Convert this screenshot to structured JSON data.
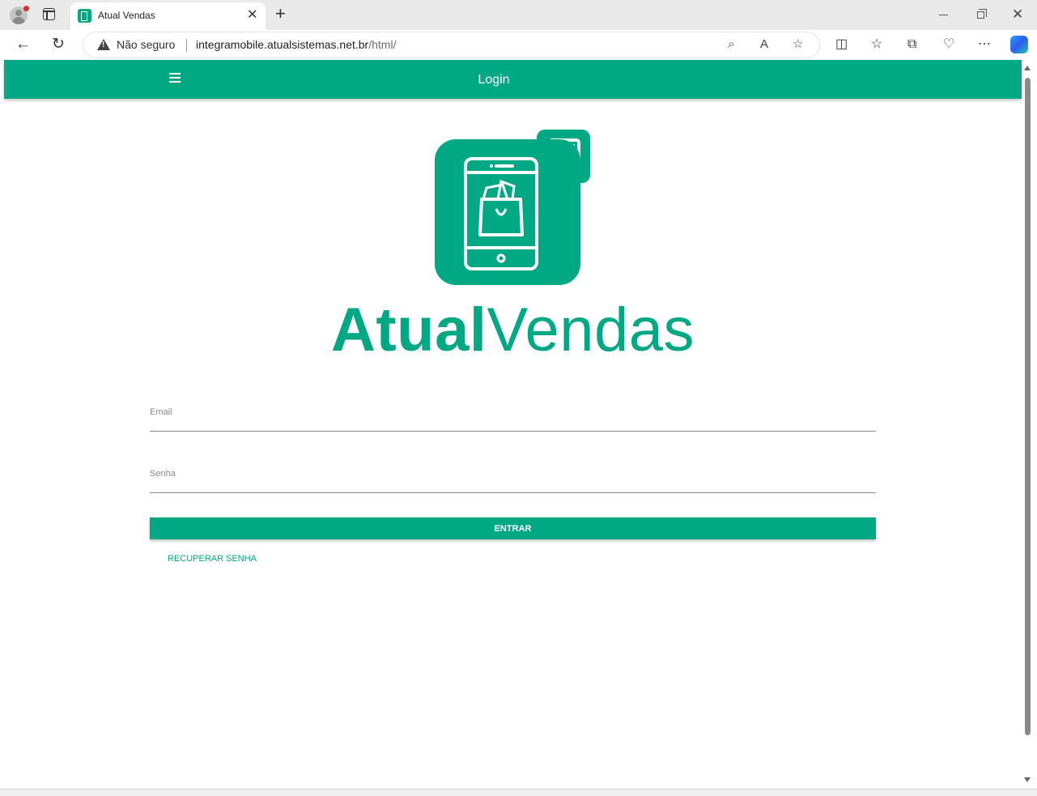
{
  "browser": {
    "tab_title": "Atual Vendas",
    "security_label": "Não seguro",
    "url_host": "integramobile.atualsistemas.net.br",
    "url_path": "/html/"
  },
  "appbar": {
    "title": "Login"
  },
  "logo": {
    "word_bold": "Atual",
    "word_light": "Vendas"
  },
  "form": {
    "email_label": "Email",
    "email_value": "",
    "password_label": "Senha",
    "password_value": "",
    "submit_label": "ENTRAR",
    "recover_label": "RECUPERAR SENHA"
  },
  "colors": {
    "brand": "#00a884",
    "underline": "#8a8a8a"
  }
}
